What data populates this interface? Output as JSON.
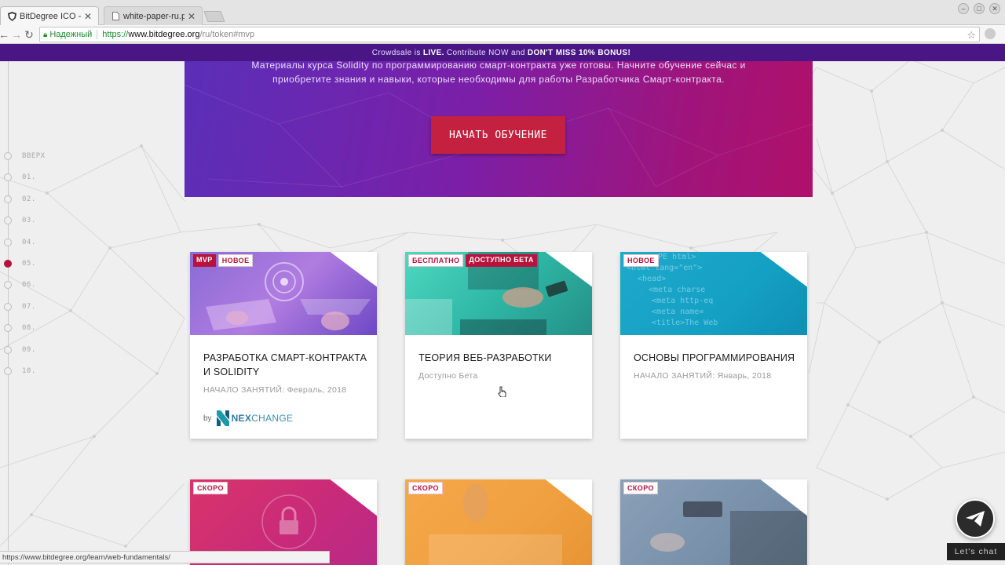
{
  "browser": {
    "tabs": [
      {
        "title": "BitDegree ICO - Эволю",
        "active": true
      },
      {
        "title": "white-paper-ru.pdf",
        "active": false
      }
    ],
    "security_label": "Надежный",
    "url_scheme": "https://",
    "url_host": "www.bitdegree.org",
    "url_path": "/ru/token#mvp",
    "status_url": "https://www.bitdegree.org/learn/web-fundamentals/"
  },
  "banner": {
    "pre": "Crowdsale is",
    "live": "LIVE.",
    "mid": "Contribute NOW and",
    "bonus": "DON'T MISS 10% BONUS!"
  },
  "hero": {
    "line1": "Материалы курса Solidity по программированию смарт-контракта уже готовы. Начните обучение сейчас и",
    "line2": "приобретите знания и навыки, которые необходимы для работы Разработчика Смарт-контракта.",
    "button": "НАЧАТЬ ОБУЧЕНИЕ"
  },
  "side_nav": {
    "items": [
      "ВВЕРХ",
      "01.",
      "02.",
      "03.",
      "04.",
      "05.",
      "06.",
      "07.",
      "08.",
      "09.",
      "10."
    ],
    "active_index": 5
  },
  "cards": [
    {
      "badges": [
        {
          "text": "MVP",
          "style": "red"
        },
        {
          "text": "НОВОЕ",
          "style": "white"
        }
      ],
      "title": "РАЗРАБОТКА СМАРТ-КОНТРАКТА И SOLIDITY",
      "subtitle": "НАЧАЛО ЗАНЯТИЙ: Февраль, 2018",
      "by": "by",
      "brand_bold": "NEX",
      "brand_rest": "CHANGE"
    },
    {
      "badges": [
        {
          "text": "БЕСПЛАТНО",
          "style": "white"
        },
        {
          "text": "ДОСТУПНО БЕТА",
          "style": "red"
        }
      ],
      "title": "ТЕОРИЯ ВЕБ-РАЗРАБОТКИ",
      "subtitle": "Доступно Бета"
    },
    {
      "badges": [
        {
          "text": "НОВОЕ",
          "style": "white"
        }
      ],
      "title": "ОСНОВЫ ПРОГРАММИРОВАНИЯ",
      "subtitle": "НАЧАЛО ЗАНЯТИЙ: Январь, 2018"
    },
    {
      "badges": [
        {
          "text": "СКОРО",
          "style": "white"
        }
      ]
    },
    {
      "badges": [
        {
          "text": "СКОРО",
          "style": "white"
        }
      ]
    },
    {
      "badges": [
        {
          "text": "СКОРО",
          "style": "white"
        }
      ]
    }
  ],
  "card_code_lines": [
    "PE html>",
    "<html lang=\"en\">",
    "<head>",
    "<meta charse",
    "<meta http-eq",
    "<meta name=",
    "<title>The Web"
  ],
  "chat": {
    "label": "Let's chat"
  },
  "colors": {
    "accent": "#b8123d",
    "banner": "#4a1686",
    "hero_start": "#5a2fb8",
    "hero_end": "#b0106a"
  }
}
